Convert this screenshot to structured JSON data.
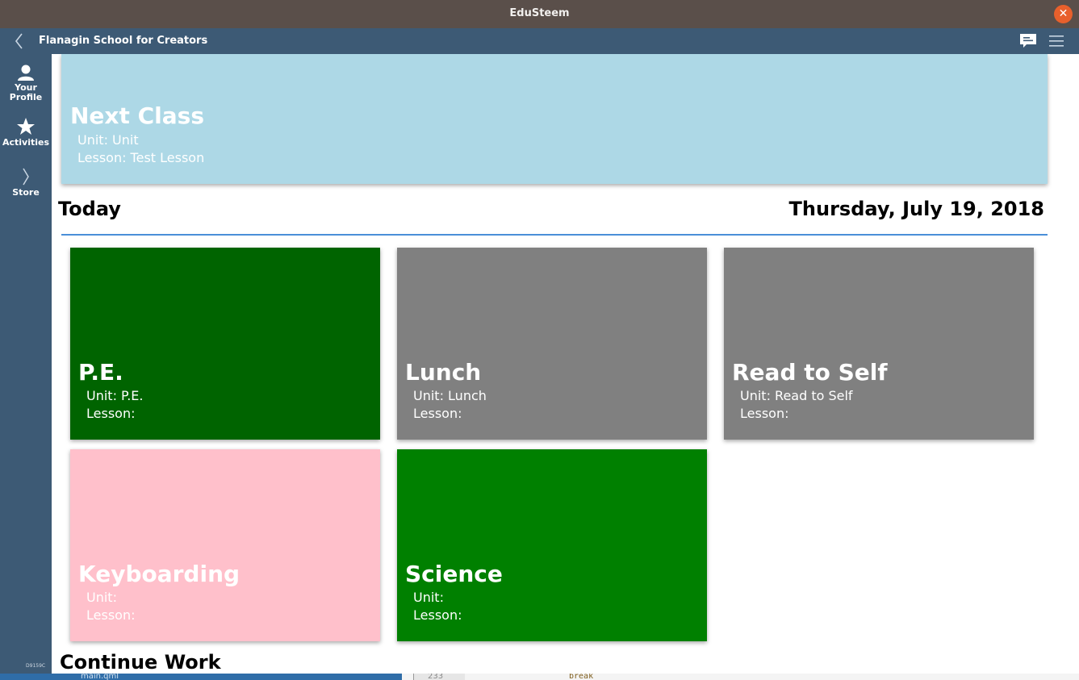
{
  "window": {
    "title": "EduSteem",
    "close_icon": "close-icon"
  },
  "header": {
    "school": "Flanagin School for Creators"
  },
  "sidebar": {
    "items": [
      {
        "label_line1": "Your",
        "label_line2": "Profile",
        "icon": "person-icon"
      },
      {
        "label": "Activities",
        "icon": "star-icon"
      },
      {
        "label": "Store",
        "icon": "chevron-right-icon"
      }
    ],
    "version": "D9159C"
  },
  "next_class": {
    "title": "Next Class",
    "unit": "Unit: Unit",
    "lesson": "Lesson: Test Lesson",
    "color": "#add8e6"
  },
  "today": {
    "heading": "Today",
    "date": "Thursday, July 19, 2018",
    "rule_color": "#4a8fd8"
  },
  "classes": [
    {
      "title": "P.E.",
      "unit": "Unit: P.E.",
      "lesson": "Lesson:",
      "color": "#006400"
    },
    {
      "title": "Lunch",
      "unit": "Unit: Lunch",
      "lesson": "Lesson:",
      "color": "#808080"
    },
    {
      "title": "Read to Self",
      "unit": "Unit: Read to Self",
      "lesson": "Lesson:",
      "color": "#808080"
    },
    {
      "title": "Keyboarding",
      "unit": "Unit:",
      "lesson": "Lesson:",
      "color": "#ffc0cb"
    },
    {
      "title": "Science",
      "unit": "Unit:",
      "lesson": "Lesson:",
      "color": "#008000"
    }
  ],
  "continue_work": {
    "heading": "Continue Work"
  },
  "background": {
    "file": "main.qml",
    "line": "233",
    "code": "break"
  }
}
